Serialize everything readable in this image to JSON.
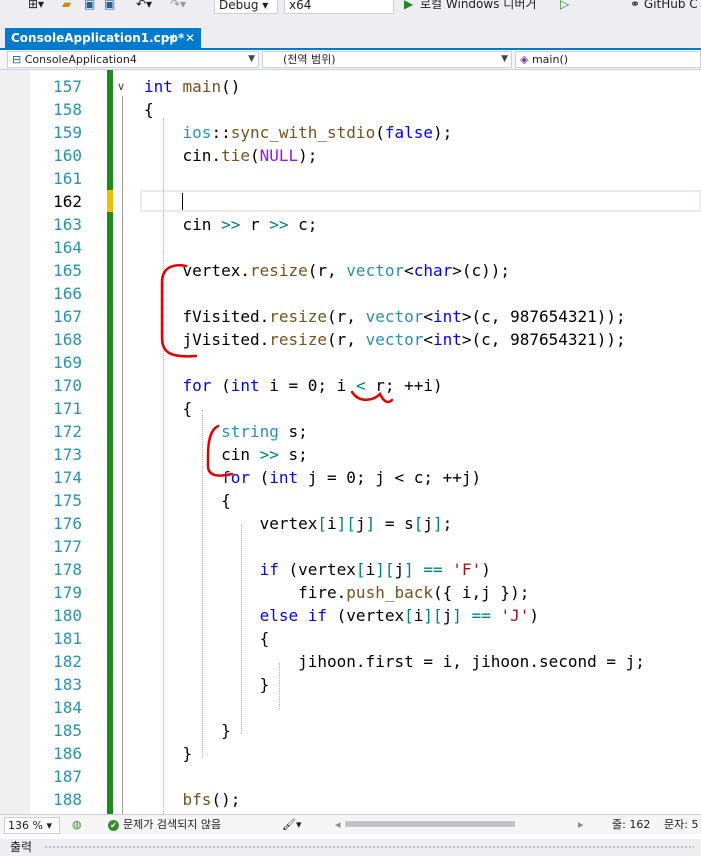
{
  "toolbar": {
    "config": "Debug",
    "platform": "x64",
    "run_label": "로컬 Windows 디버거",
    "github_label": "GitHub C"
  },
  "tab": {
    "title": "ConsoleApplication1.cpp*",
    "pin_glyph": "⊣",
    "close_glyph": "✕"
  },
  "nav": {
    "project": "ConsoleApplication4",
    "scope": "(전역 범위)",
    "member": "main()"
  },
  "editor": {
    "current_line": 162,
    "lines": [
      {
        "n": 157,
        "html": "<span class=\"kw\">int</span> <span class=\"fn\">main</span>()"
      },
      {
        "n": 158,
        "html": "{"
      },
      {
        "n": 159,
        "html": "    <span class=\"ns\">ios</span>::<span class=\"fn\">sync_with_stdio</span>(<span class=\"kw\">false</span>);"
      },
      {
        "n": 160,
        "html": "    cin.<span class=\"fn\">tie</span>(<span class=\"mac\">NULL</span>);"
      },
      {
        "n": 161,
        "html": ""
      },
      {
        "n": 162,
        "html": ""
      },
      {
        "n": 163,
        "html": "    cin <span class=\"op\">&gt;&gt;</span> r <span class=\"op\">&gt;&gt;</span> c;"
      },
      {
        "n": 164,
        "html": ""
      },
      {
        "n": 165,
        "html": "    vertex.<span class=\"fn\">resize</span>(r, <span class=\"ty\">vector</span>&lt;<span class=\"kw\">char</span>&gt;(c));"
      },
      {
        "n": 166,
        "html": ""
      },
      {
        "n": 167,
        "html": "    fVisited.<span class=\"fn\">resize</span>(r, <span class=\"ty\">vector</span>&lt;<span class=\"kw\">int</span>&gt;(c, 987654321));"
      },
      {
        "n": 168,
        "html": "    jVisited.<span class=\"fn\">resize</span>(r, <span class=\"ty\">vector</span>&lt;<span class=\"kw\">int</span>&gt;(c, 987654321));"
      },
      {
        "n": 169,
        "html": ""
      },
      {
        "n": 170,
        "html": "    <span class=\"kw\">for</span> (<span class=\"kw\">int</span> i = 0; i <span class=\"op\">&lt;</span> r; ++i)"
      },
      {
        "n": 171,
        "html": "    {"
      },
      {
        "n": 172,
        "html": "        <span class=\"ty\">string</span> s;"
      },
      {
        "n": 173,
        "html": "        cin <span class=\"op\">&gt;&gt;</span> s;"
      },
      {
        "n": 174,
        "html": "        <span class=\"kw\">for</span> (<span class=\"kw\">int</span> j = 0; j &lt; c; ++j)"
      },
      {
        "n": 175,
        "html": "        {"
      },
      {
        "n": 176,
        "html": "            vertex<span class=\"op\">[</span>i<span class=\"op\">][</span>j<span class=\"op\">]</span> = s<span class=\"op\">[</span>j<span class=\"op\">]</span>;"
      },
      {
        "n": 177,
        "html": ""
      },
      {
        "n": 178,
        "html": "            <span class=\"kw\">if</span> (vertex<span class=\"op\">[</span>i<span class=\"op\">][</span>j<span class=\"op\">]</span> <span class=\"op\">==</span> <span class=\"str\">'F'</span>)"
      },
      {
        "n": 179,
        "html": "                fire.<span class=\"fn\">push_back</span>({ i,j });"
      },
      {
        "n": 180,
        "html": "            <span class=\"kw\">else</span> <span class=\"kw\">if</span> (vertex<span class=\"op\">[</span>i<span class=\"op\">][</span>j<span class=\"op\">]</span> <span class=\"op\">==</span> <span class=\"str\">'J'</span>)"
      },
      {
        "n": 181,
        "html": "            {"
      },
      {
        "n": 182,
        "html": "                jihoon.first = i, jihoon.second = j;"
      },
      {
        "n": 183,
        "html": "            }"
      },
      {
        "n": 184,
        "html": ""
      },
      {
        "n": 185,
        "html": "        }"
      },
      {
        "n": 186,
        "html": "    }"
      },
      {
        "n": 187,
        "html": ""
      },
      {
        "n": 188,
        "html": "    <span class=\"fn\">bfs</span>();"
      }
    ]
  },
  "statusbar": {
    "zoom": "136 %",
    "problems": "문제가 검색되지 않음",
    "line_label": "줄: 162",
    "col_label": "문자: 5"
  },
  "output": {
    "label": "출력"
  },
  "colors": {
    "accent": "#007acc",
    "change_bar": "#1f8a1f",
    "annotation": "#e00000"
  }
}
